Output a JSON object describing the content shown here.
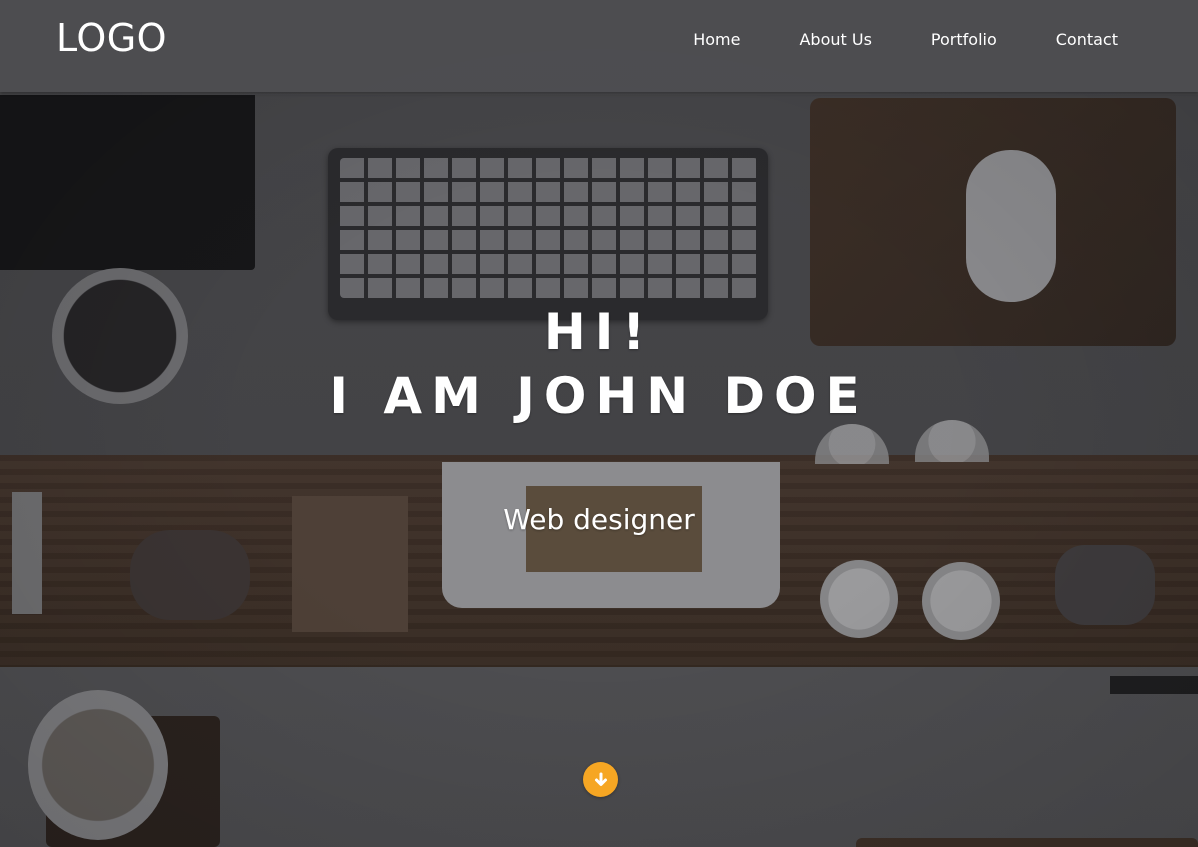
{
  "header": {
    "logo": "LOGO",
    "nav": [
      {
        "label": "Home"
      },
      {
        "label": "About Us"
      },
      {
        "label": "Portfolio"
      },
      {
        "label": "Contact"
      }
    ]
  },
  "hero": {
    "greeting": "HI!",
    "name": "I AM JOHN DOE",
    "subtitle": "Web designer",
    "background": "desk-workspace-photo",
    "scroll_icon": "arrow-down-circle-icon"
  },
  "colors": {
    "accent": "#f6a623",
    "overlay": "#4a4a4d",
    "text": "#ffffff"
  }
}
